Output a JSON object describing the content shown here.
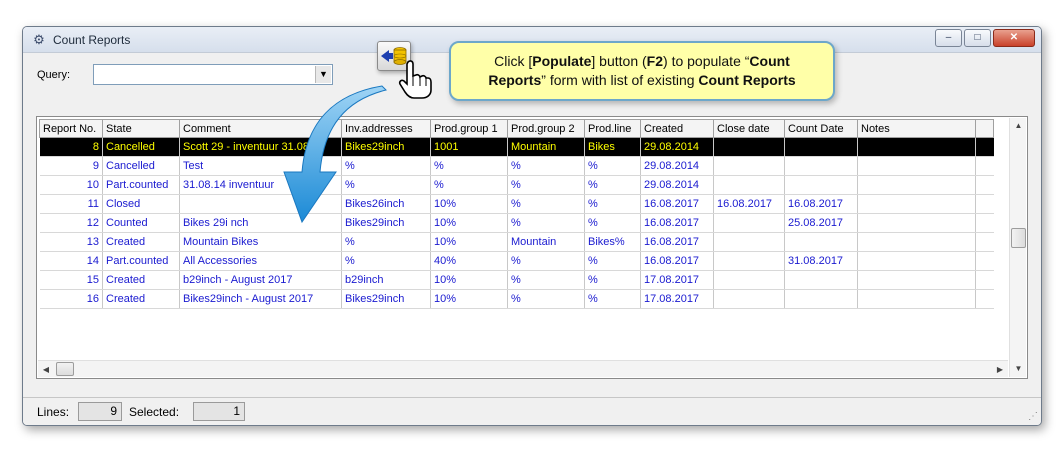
{
  "window": {
    "title": "Count Reports",
    "title_icon": "grid-gear-icon",
    "controls": {
      "minimize": "–",
      "maximize": "□",
      "close": "✕"
    }
  },
  "query": {
    "label": "Query:",
    "value": ""
  },
  "callout": {
    "part1": "Click [",
    "bold1": "Populate",
    "part2": "] button (",
    "bold2": "F2",
    "part3": ") to populate “",
    "bold3": "Count",
    "bold3b": "Reports",
    "part4": "” form with list of existing ",
    "bold4": "Count Reports"
  },
  "grid": {
    "columns": [
      "Report No.",
      "State",
      "Comment",
      "Inv.addresses",
      "Prod.group 1",
      "Prod.group 2",
      "Prod.line",
      "Created",
      "Close date",
      "Count Date",
      "Notes"
    ],
    "rows": [
      [
        "8",
        "Cancelled",
        "Scott 29 - inventuur 31.08.14",
        "Bikes29inch",
        "1001",
        "Mountain",
        "Bikes",
        "29.08.2014",
        "",
        "",
        ""
      ],
      [
        "9",
        "Cancelled",
        "Test",
        "%",
        "%",
        "%",
        "%",
        "29.08.2014",
        "",
        "",
        ""
      ],
      [
        "10",
        "Part.counted",
        "31.08.14 inventuur",
        "%",
        "%",
        "%",
        "%",
        "29.08.2014",
        "",
        "",
        ""
      ],
      [
        "11",
        "Closed",
        "",
        "Bikes26inch",
        "10%",
        "%",
        "%",
        "16.08.2017",
        "16.08.2017",
        "16.08.2017",
        ""
      ],
      [
        "12",
        "Counted",
        "Bikes 29i nch",
        "Bikes29inch",
        "10%",
        "%",
        "%",
        "16.08.2017",
        "",
        "25.08.2017",
        ""
      ],
      [
        "13",
        "Created",
        "Mountain Bikes",
        "%",
        "10%",
        "Mountain",
        "Bikes%",
        "16.08.2017",
        "",
        "",
        ""
      ],
      [
        "14",
        "Part.counted",
        "All Accessories",
        "%",
        "40%",
        "%",
        "%",
        "16.08.2017",
        "",
        "31.08.2017",
        ""
      ],
      [
        "15",
        "Created",
        "b29inch - August 2017",
        "b29inch",
        "10%",
        "%",
        "%",
        "17.08.2017",
        "",
        "",
        ""
      ],
      [
        "16",
        "Created",
        "Bikes29inch - August 2017",
        "Bikes29inch",
        "10%",
        "%",
        "%",
        "17.08.2017",
        "",
        "",
        ""
      ]
    ],
    "selected_row_index": 0
  },
  "status": {
    "lines_label": "Lines:",
    "lines_value": "9",
    "selected_label": "Selected:",
    "selected_value": "1"
  },
  "colors": {
    "row_text": "#1a1ad0",
    "selected_bg": "#000000",
    "selected_text": "#ffff00",
    "callout_bg": "#ffffa8",
    "callout_border": "#6da7ca",
    "arrow": "#2e9fe0"
  },
  "icons": [
    "populate-database-icon",
    "pointing-hand-cursor-icon",
    "curved-arrow-icon"
  ]
}
